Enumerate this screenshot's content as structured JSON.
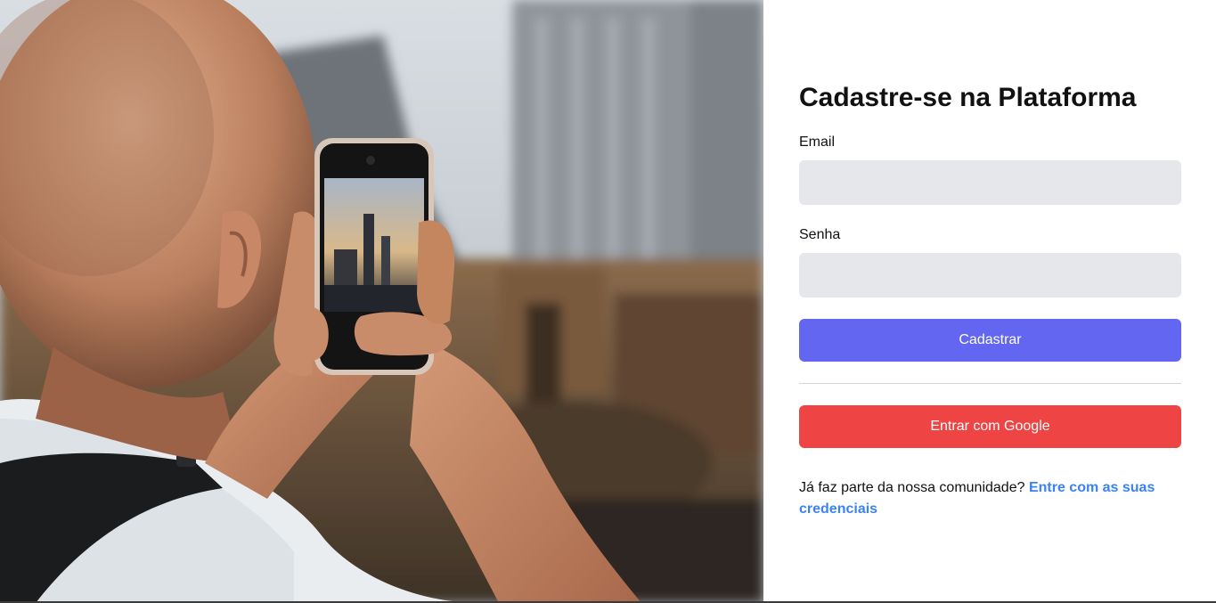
{
  "hero": {
    "image": "person-photographing-city-skyline-with-phone"
  },
  "signup": {
    "title": "Cadastre-se na Plataforma",
    "email_label": "Email",
    "email_value": "",
    "password_label": "Senha",
    "password_value": "",
    "submit_label": "Cadastrar",
    "google_label": "Entrar com Google",
    "footer_text": "Já faz parte da nossa comunidade? ",
    "footer_link": "Entre com as suas credenciais"
  },
  "colors": {
    "primary": "#6366f1",
    "google": "#ef4444",
    "link": "#3b82f6",
    "input_bg": "#e5e7eb"
  }
}
